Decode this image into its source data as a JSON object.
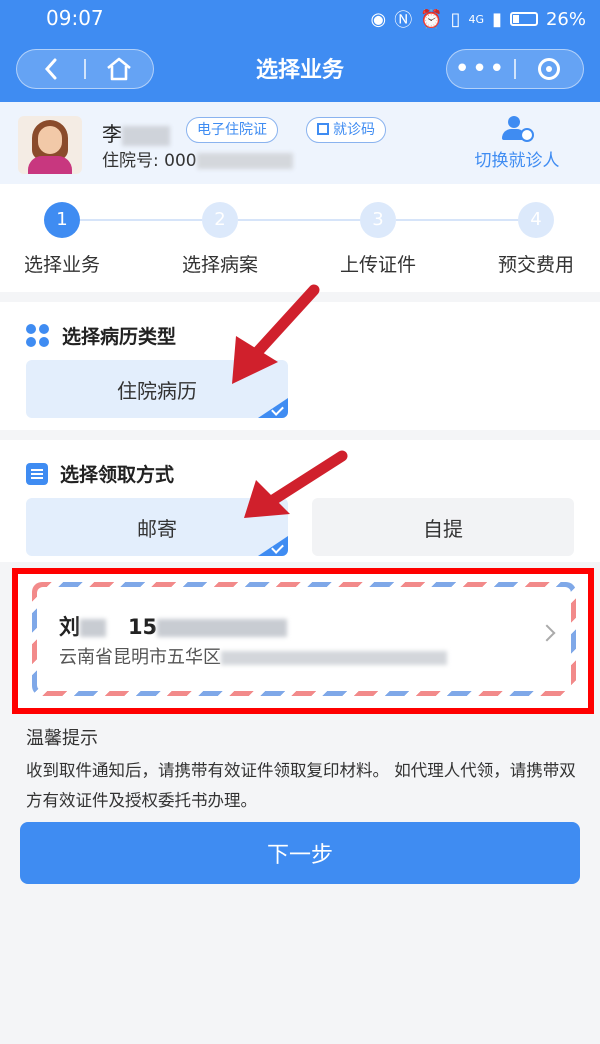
{
  "status": {
    "time": "09:07",
    "network": "4G",
    "battery": "26%"
  },
  "nav": {
    "title": "选择业务",
    "back_icon": "back-icon",
    "home_icon": "home-icon"
  },
  "patient": {
    "name_visible": "李",
    "tag_inpatient": "电子住院证",
    "tag_visit": "就诊码",
    "admission_label": "住院号:",
    "admission_visible": "000",
    "switch_label": "切换就诊人"
  },
  "steps": [
    {
      "num": "1",
      "label": "选择业务"
    },
    {
      "num": "2",
      "label": "选择病案"
    },
    {
      "num": "3",
      "label": "上传证件"
    },
    {
      "num": "4",
      "label": "预交费用"
    }
  ],
  "record_type": {
    "title": "选择病历类型",
    "option": "住院病历"
  },
  "pickup": {
    "title": "选择领取方式",
    "option_mail": "邮寄",
    "option_self": "自提"
  },
  "address": {
    "name_visible": "刘",
    "phone_visible": "15",
    "line_visible": "云南省昆明市五华区"
  },
  "tips": {
    "title": "温馨提示",
    "text": "收到取件通知后，请携带有效证件领取复印材料。 如代理人代领，请携带双方有效证件及授权委托书办理。"
  },
  "next_button": "下一步",
  "colors": {
    "primary": "#3f8cf2",
    "highlight_frame": "#ff0000",
    "annotation_arrow": "#d0202c"
  }
}
